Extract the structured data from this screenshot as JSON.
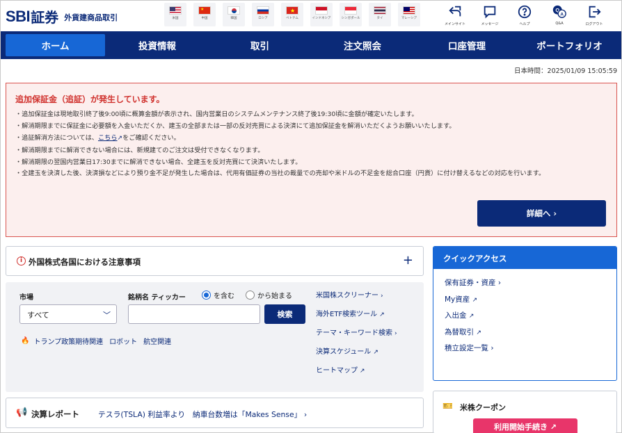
{
  "header": {
    "logo_main": "SBI",
    "logo_sec": "証券",
    "logo_sub": "外貨建商品取引",
    "flags": [
      {
        "label": "米国",
        "icon": "us-flag"
      },
      {
        "label": "中国",
        "icon": "cn-flag"
      },
      {
        "label": "韓国",
        "icon": "kr-flag"
      },
      {
        "label": "ロシア",
        "icon": "ru-flag"
      },
      {
        "label": "ベトナム",
        "icon": "vn-flag"
      },
      {
        "label": "インドネシア",
        "icon": "id-flag"
      },
      {
        "label": "シンガポール",
        "icon": "sg-flag"
      },
      {
        "label": "タイ",
        "icon": "th-flag"
      },
      {
        "label": "マレーシア",
        "icon": "my-flag"
      }
    ],
    "utilities": [
      {
        "label": "メインサイト",
        "icon": "return-icon"
      },
      {
        "label": "メッセージ",
        "icon": "message-icon"
      },
      {
        "label": "ヘルプ",
        "icon": "help-icon"
      },
      {
        "label": "Q&A",
        "icon": "qa-icon"
      },
      {
        "label": "ログアウト",
        "icon": "logout-icon"
      }
    ]
  },
  "nav": {
    "items": [
      "ホーム",
      "投資情報",
      "取引",
      "注文照会",
      "口座管理",
      "ポートフォリオ"
    ]
  },
  "time": "日本時間：2025/01/09 15:05:59",
  "alert": {
    "title": "追加保証金（追証）が発生しています。",
    "items": [
      "・追加保証金は現地取引終了後9:00頃に概算金額が表示され、国内営業日のシステムメンテナンス終了後19:30頃に金額が確定いたします。",
      "・解消期限までに保証金に必要額を入金いただくか、建玉の全部または一部の反対売買による決済にて追加保証金を解消いただくようお願いいたします。",
      "・解消期限までに解消できない場合には、新規建てのご注文は受付できなくなります。",
      "・解消期限の翌国内営業日17:30までに解消できない場合、全建玉を反対売買にて決済いたします。",
      "・全建玉を決済した後、決済損などにより預り金不足が発生した場合は、代用有価証券の当社の裁量での売却や米ドルの不足金を総合口座（円貨）に付け替えるなどの対応を行います。"
    ],
    "method_prefix": "・追証解消方法については、",
    "method_link": "こちら",
    "method_suffix": "をご確認ください。",
    "button": "詳細へ ›"
  },
  "notice": {
    "title": "外国株式各国における注意事項",
    "plus": "+"
  },
  "search": {
    "market_label": "市場",
    "market_value": "すべて",
    "ticker_label": "銘柄名 ティッカー",
    "radio_contains": "を含む",
    "radio_starts": "から始まる",
    "button": "検索",
    "tags": [
      "トランプ政策期待関連",
      "ロボット",
      "航空関連"
    ],
    "links": [
      {
        "label": "米国株スクリーナー",
        "suffix": "›"
      },
      {
        "label": "海外ETF検索ツール",
        "suffix": "↗"
      },
      {
        "label": "テーマ・キーワード検索",
        "suffix": "›"
      },
      {
        "label": "決算スケジュール",
        "suffix": "↗"
      },
      {
        "label": "ヒートマップ",
        "suffix": "↗"
      }
    ]
  },
  "report": {
    "title": "決算レポート",
    "text": "テスラ(TSLA) 利益率より　納車台数増は「Makes Sense」 ›"
  },
  "quick_access": {
    "title": "クイックアクセス",
    "items": [
      {
        "label": "保有証券・資産",
        "suffix": "›"
      },
      {
        "label": "My資産",
        "suffix": "↗"
      },
      {
        "label": "入出金",
        "suffix": "↗"
      },
      {
        "label": "為替取引",
        "suffix": "↗"
      },
      {
        "label": "積立設定一覧",
        "suffix": "›"
      }
    ]
  },
  "coupon": {
    "title": "米株クーポン",
    "button": "利用開始手続き ↗"
  },
  "colors": {
    "brand": "#0b2a78",
    "accent": "#1767d6",
    "alert": "#d0312d",
    "coupon": "#e8356a"
  }
}
